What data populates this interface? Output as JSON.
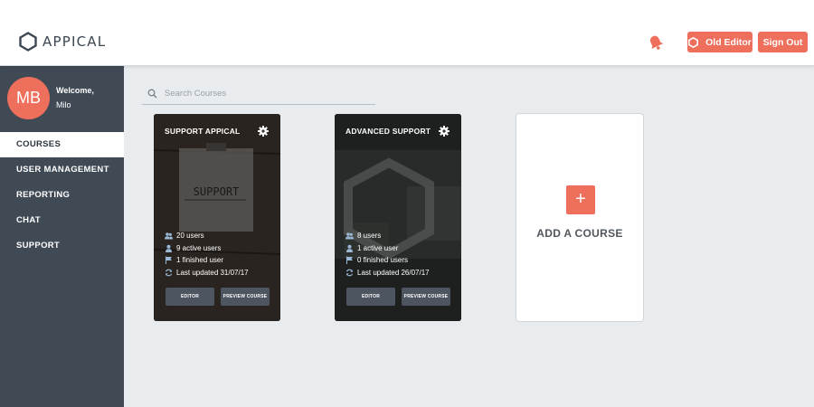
{
  "header": {
    "brand": "APPICAL",
    "old_editor_label": "Old Editor",
    "sign_out_label": "Sign Out"
  },
  "sidebar": {
    "avatar_initials": "MB",
    "welcome_line": "Welcome,",
    "user_name": "Milo",
    "items": [
      {
        "label": "COURSES",
        "active": true
      },
      {
        "label": "USER MANAGEMENT",
        "active": false
      },
      {
        "label": "REPORTING",
        "active": false
      },
      {
        "label": "CHAT",
        "active": false
      },
      {
        "label": "SUPPORT",
        "active": false
      }
    ]
  },
  "search": {
    "placeholder": "Search Courses"
  },
  "courses": [
    {
      "title": "SUPPORT APPICAL",
      "users": "20 users",
      "active_users": "9 active users",
      "finished": "1 finished user",
      "updated": "Last updated 31/07/17",
      "editor_label": "EDITOR",
      "preview_label": "PREVIEW COURSE",
      "image_text": "SUPPORT"
    },
    {
      "title": "ADVANCED SUPPORT",
      "users": "8 users",
      "active_users": "1 active user",
      "finished": "0 finished users",
      "updated": "Last updated 26/07/17",
      "editor_label": "EDITOR",
      "preview_label": "PREVIEW COURSE"
    }
  ],
  "add_course": {
    "plus": "+",
    "label": "ADD A COURSE"
  },
  "colors": {
    "accent": "#ee6f5b",
    "sidebar": "#404a55",
    "background": "#e9ecef"
  }
}
